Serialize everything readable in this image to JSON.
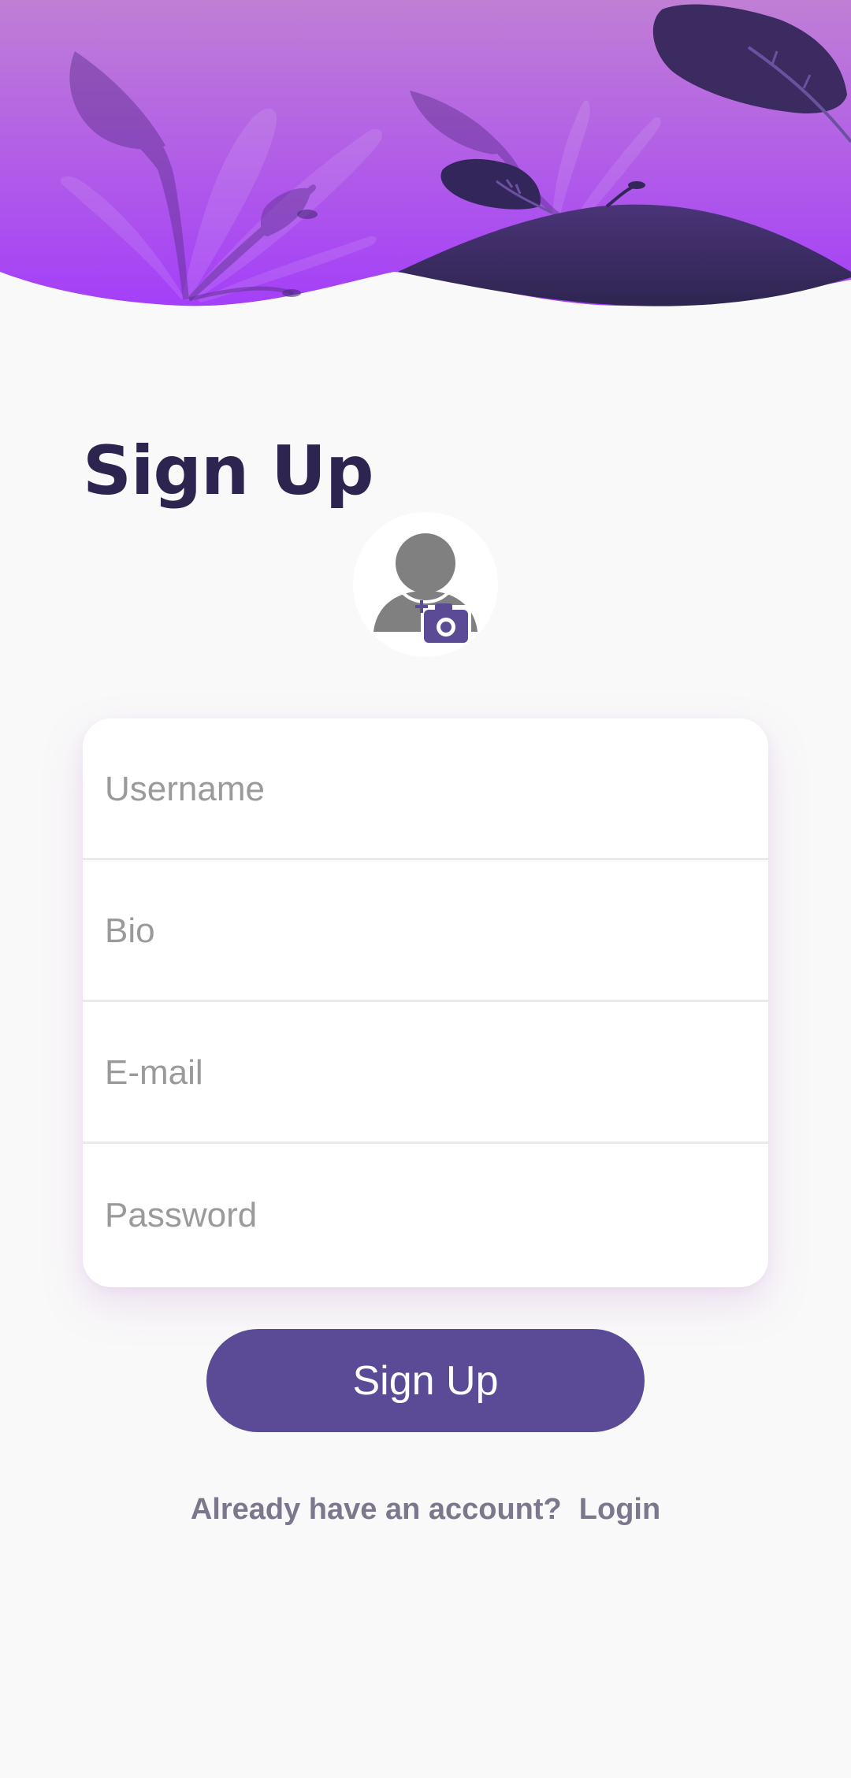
{
  "colors": {
    "header_top": "#c07fd5",
    "header_bottom": "#a43ff8",
    "hill": "#3a2a60",
    "title": "#2d2550",
    "button": "#5b4b96",
    "avatar": "#808080",
    "camera": "#5b4b96",
    "link_text": "#7d778e"
  },
  "page": {
    "title": "Sign Up"
  },
  "avatar": {
    "icon": "person-icon",
    "badge_icon": "add-camera-icon"
  },
  "form": {
    "username_placeholder": "Username",
    "bio_placeholder": "Bio",
    "email_placeholder": "E-mail",
    "password_placeholder": "Password"
  },
  "actions": {
    "signup_label": "Sign Up",
    "already_text": "Already have an account?",
    "login_label": "Login"
  }
}
